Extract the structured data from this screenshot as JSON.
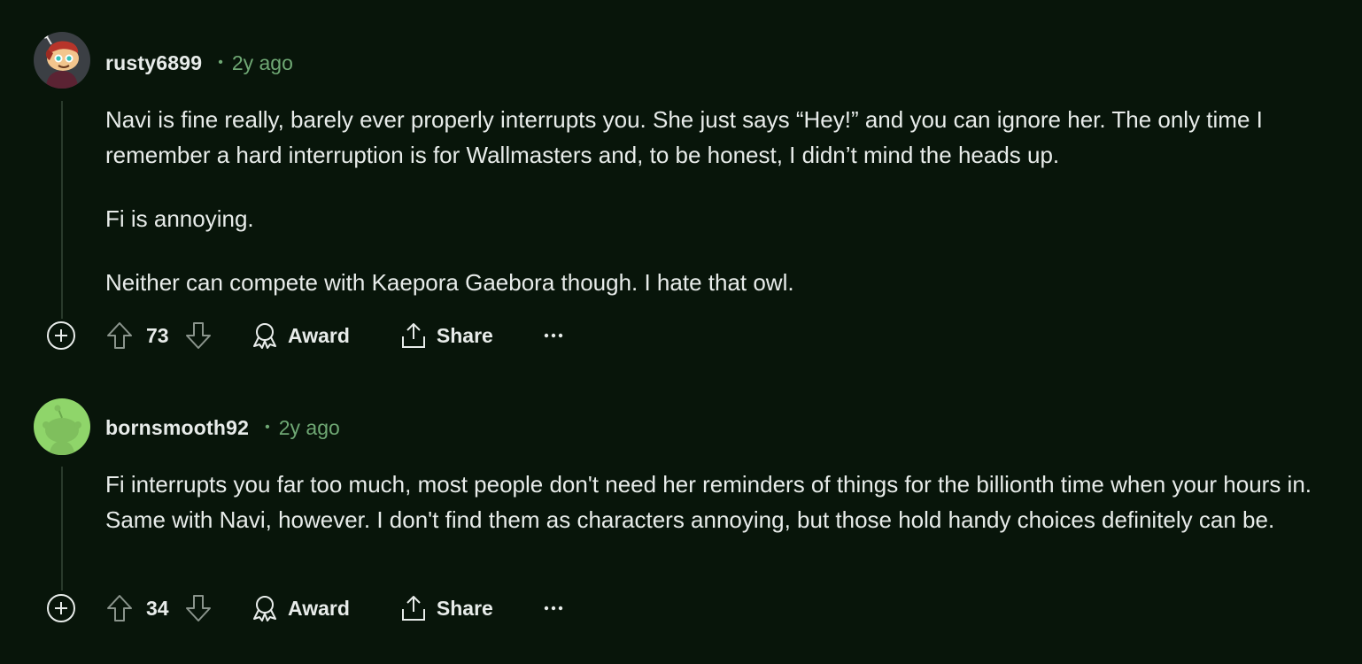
{
  "comments": [
    {
      "username": "rusty6899",
      "time": "2y ago",
      "avatar_icon": "snoo-avatar-red-hat-icon",
      "paragraphs": [
        "Navi is fine really, barely ever properly interrupts you. She just says “Hey!” and you can ignore her. The only time I remember a hard interruption is for Wallmasters and, to be honest, I didn’t mind the heads up.",
        "Fi is annoying.",
        "Neither can compete with Kaepora Gaebora though. I hate that owl."
      ],
      "score": "73",
      "award_label": "Award",
      "share_label": "Share"
    },
    {
      "username": "bornsmooth92",
      "time": "2y ago",
      "avatar_icon": "snoo-avatar-default-green-icon",
      "paragraphs": [
        "Fi interrupts you far too much, most people don't need her reminders of things for the billionth time when your hours in. Same with Navi, however. I don't find them as characters annoying, but those hold handy choices definitely can be."
      ],
      "score": "34",
      "award_label": "Award",
      "share_label": "Share"
    }
  ],
  "colors": {
    "background": "#08150a",
    "text": "#e8ecea",
    "meta": "#6fa874",
    "thread_line": "#2a3a2c",
    "avatar_green_bg": "#8fd56a"
  }
}
